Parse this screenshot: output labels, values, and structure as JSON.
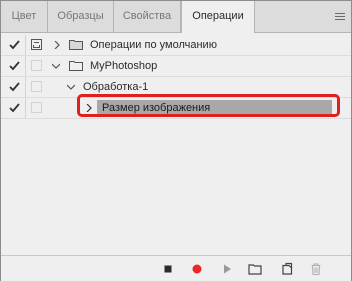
{
  "tabs": [
    {
      "label": "Цвет",
      "active": false
    },
    {
      "label": "Образцы",
      "active": false
    },
    {
      "label": "Свойства",
      "active": false
    },
    {
      "label": "Операции",
      "active": true
    }
  ],
  "actions": [
    {
      "label": "Операции по умолчанию",
      "checked": true,
      "expanded": false
    },
    {
      "label": "MyPhotoshop",
      "checked": true,
      "expanded": true
    },
    {
      "label": "Обработка-1",
      "checked": true,
      "expanded": true
    },
    {
      "label": "Размер изображения",
      "checked": true,
      "expanded": false,
      "selected": true
    }
  ],
  "footer": {
    "buttons": [
      "stop",
      "record",
      "play",
      "new-set",
      "new-action",
      "delete"
    ]
  },
  "colors": {
    "record": "#e8282b",
    "highlight": "#e02020",
    "selected_row": "#a8a8a8"
  }
}
